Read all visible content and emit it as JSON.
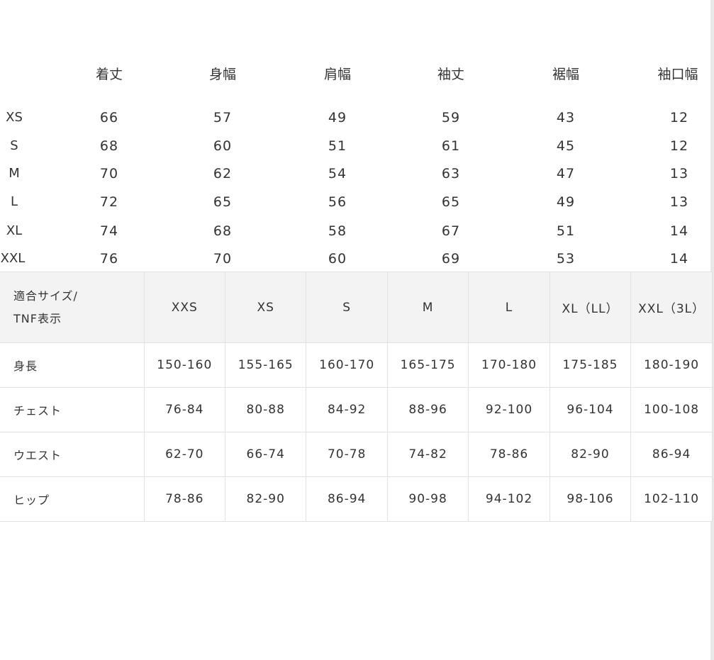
{
  "garment_table": {
    "headers": [
      "着丈",
      "身幅",
      "肩幅",
      "袖丈",
      "裾幅",
      "袖口幅"
    ],
    "rows": [
      {
        "size": "XS",
        "values": [
          "66",
          "57",
          "49",
          "59",
          "43",
          "12"
        ]
      },
      {
        "size": "S",
        "values": [
          "68",
          "60",
          "51",
          "61",
          "45",
          "12"
        ]
      },
      {
        "size": "M",
        "values": [
          "70",
          "62",
          "54",
          "63",
          "47",
          "13"
        ]
      },
      {
        "size": "L",
        "values": [
          "72",
          "65",
          "56",
          "65",
          "49",
          "13"
        ]
      },
      {
        "size": "XL",
        "values": [
          "74",
          "68",
          "58",
          "67",
          "51",
          "14"
        ]
      },
      {
        "size": "XXL",
        "values": [
          "76",
          "70",
          "60",
          "69",
          "53",
          "14"
        ]
      }
    ]
  },
  "body_table": {
    "header_label_line1": "適合サイズ/",
    "header_label_line2": "TNF表示",
    "sizes": [
      "XXS",
      "XS",
      "S",
      "M",
      "L",
      "XL（LL）",
      "XXL（3L）"
    ],
    "rows": [
      {
        "label": "身長",
        "values": [
          "150-160",
          "155-165",
          "160-170",
          "165-175",
          "170-180",
          "175-185",
          "180-190"
        ]
      },
      {
        "label": "チェスト",
        "values": [
          "76-84",
          "80-88",
          "84-92",
          "88-96",
          "92-100",
          "96-104",
          "100-108"
        ]
      },
      {
        "label": "ウエスト",
        "values": [
          "62-70",
          "66-74",
          "70-78",
          "74-82",
          "78-86",
          "82-90",
          "86-94"
        ]
      },
      {
        "label": "ヒップ",
        "values": [
          "78-86",
          "82-90",
          "86-94",
          "90-98",
          "94-102",
          "98-106",
          "102-110"
        ]
      }
    ]
  },
  "colors": {
    "text": "#333333",
    "header_bg": "#f3f3f3",
    "border": "#e2e2e2"
  }
}
